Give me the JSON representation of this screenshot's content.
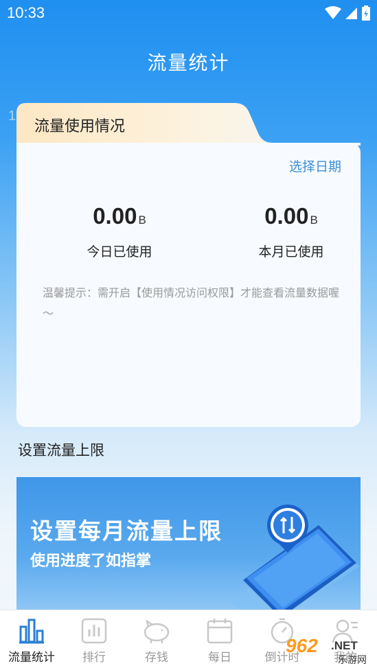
{
  "status_bar": {
    "time": "10:33"
  },
  "page": {
    "title": "流量统计",
    "watermark": "1a0a15"
  },
  "usage_card": {
    "tab_label": "流量使用情况",
    "select_date": "选择日期",
    "today": {
      "value": "0.00",
      "unit": "B",
      "label": "今日已使用"
    },
    "month": {
      "value": "0.00",
      "unit": "B",
      "label": "本月已使用"
    },
    "tip": "温馨提示：需开启【使用情况访问权限】才能查看流量数据喔～"
  },
  "limit_section": {
    "title": "设置流量上限",
    "banner_title": "设置每月流量上限",
    "banner_subtitle": "使用进度了如指掌"
  },
  "bottom_nav": {
    "items": [
      {
        "label": "流量统计",
        "icon": "bar-chart-icon",
        "active": true
      },
      {
        "label": "排行",
        "icon": "ranking-icon",
        "active": false
      },
      {
        "label": "存钱",
        "icon": "piggy-bank-icon",
        "active": false
      },
      {
        "label": "每日",
        "icon": "calendar-icon",
        "active": false
      },
      {
        "label": "倒计时",
        "icon": "stopwatch-icon",
        "active": false
      },
      {
        "label": "我的",
        "icon": "profile-icon",
        "active": false
      }
    ]
  },
  "corner_logo": {
    "number": "962",
    "suffix": ".NET",
    "caption": "乐游网"
  },
  "colors": {
    "accent": "#1f8ff0",
    "link": "#3a8fd8",
    "nav_active": "#2a7fd6"
  }
}
